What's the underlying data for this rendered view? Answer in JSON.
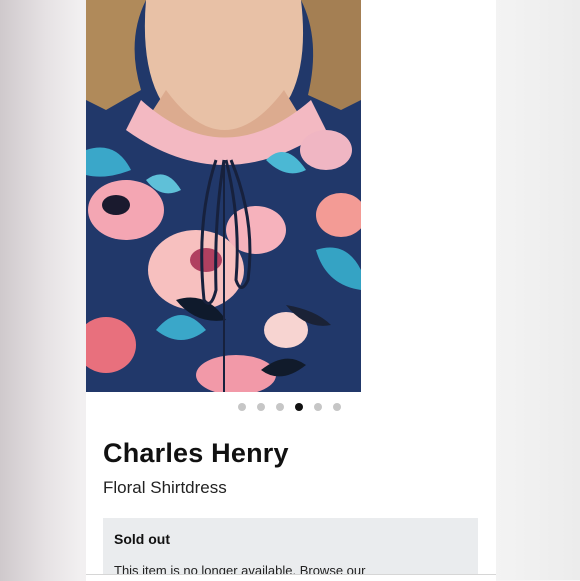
{
  "product": {
    "brand": "Charles Henry",
    "name": "Floral Shirtdress"
  },
  "carousel": {
    "total": 6,
    "active_index": 3
  },
  "availability": {
    "status": "Sold out",
    "message": "This item is no longer available. Browse our"
  },
  "colors": {
    "dress_navy": "#21386a",
    "accent_pink": "#f4a6b3",
    "accent_teal": "#3aa7c9",
    "notice_bg": "#eaecee"
  }
}
